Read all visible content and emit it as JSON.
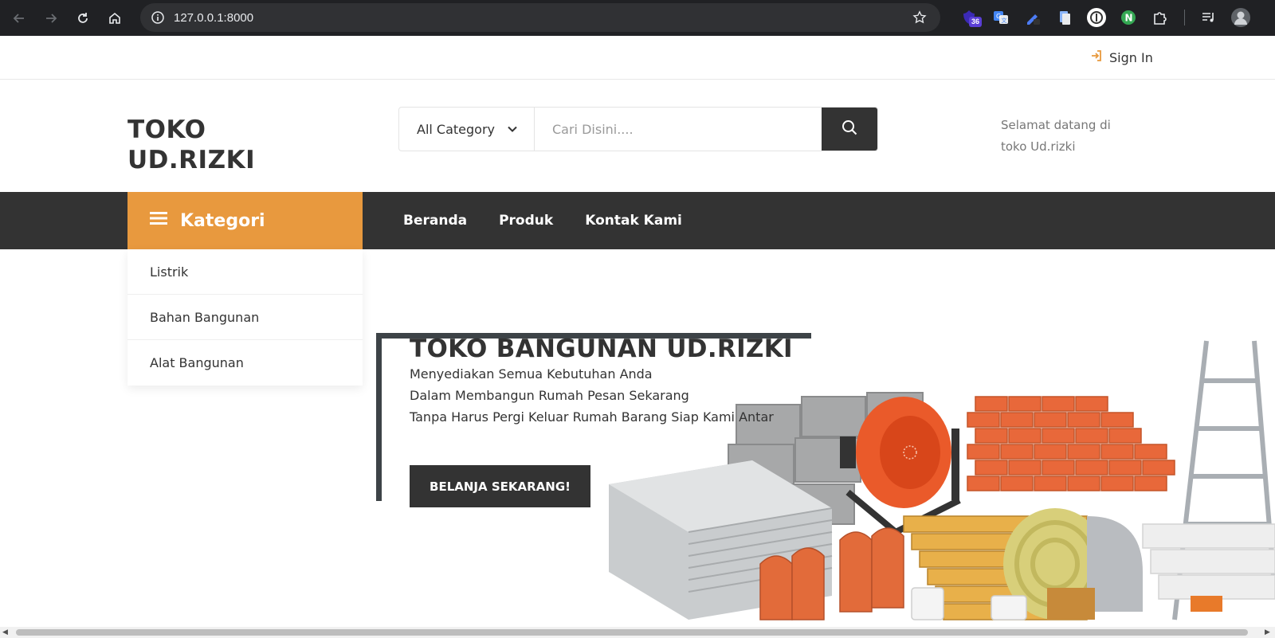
{
  "browser": {
    "url": "127.0.0.1:8000",
    "extension_badge": "36"
  },
  "topbar": {
    "signin_label": "Sign In"
  },
  "header": {
    "logo_line1": "TOKO",
    "logo_line2": "UD.RIZKI",
    "category_select": "All Category",
    "search_placeholder": "Cari Disini....",
    "welcome_line1": "Selamat datang di",
    "welcome_line2": "toko Ud.rizki"
  },
  "nav": {
    "kategori_label": "Kategori",
    "menu": [
      "Beranda",
      "Produk",
      "Kontak Kami"
    ]
  },
  "categories": [
    "Listrik",
    "Bahan Bangunan",
    "Alat Bangunan"
  ],
  "hero": {
    "title": "TOKO BANGUNAN UD.RIZKI",
    "lines": [
      "Menyediakan Semua Kebutuhan Anda",
      "Dalam Membangun Rumah Pesan Sekarang",
      "Tanpa Harus Pergi Keluar Rumah Barang Siap Kami Antar"
    ],
    "cta_label": "BELANJA SEKARANG!"
  },
  "colors": {
    "accent": "#e8993e",
    "dark": "#333333",
    "browser_chrome": "#202124"
  }
}
